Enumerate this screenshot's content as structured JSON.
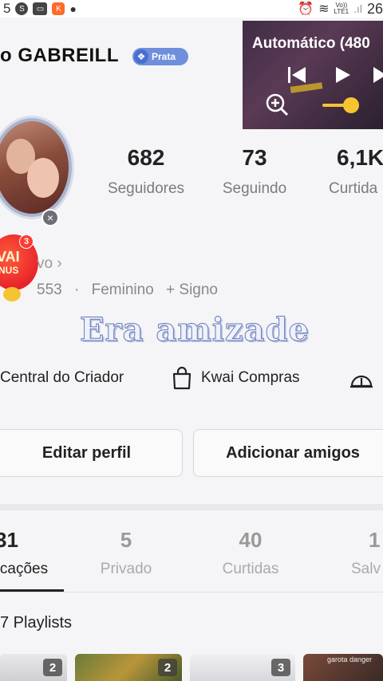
{
  "status_bar": {
    "left_text": "5",
    "right_text": "26",
    "network_label_top": "Vo))",
    "network_label_bottom": "LTE1"
  },
  "profile": {
    "username": "o GABREILL",
    "badge_label": "Prata",
    "badge_color": "#6f8fdc",
    "avatar_close": "×",
    "kwai_bonus_line1": "VAI",
    "kwai_bonus_line2": "NUS",
    "kwai_bonus_count": "3"
  },
  "video_player": {
    "title": "Automático (480",
    "zoom_level": 0.55,
    "accent_color": "#f6c430"
  },
  "stats": [
    {
      "value": "682",
      "label": "Seguidores"
    },
    {
      "value": "73",
      "label": "Seguindo"
    },
    {
      "value": "6,1K",
      "label": "Curtida"
    }
  ],
  "meta": {
    "row1": "vo ›",
    "id_fragment": "553",
    "separator": "·",
    "gender": "Feminino",
    "sign": "+ Signo"
  },
  "overlay_caption": "Era amizade",
  "shortcuts": [
    {
      "label": "Central do Criador",
      "icon": "none"
    },
    {
      "label": "Kwai Compras",
      "icon": "shopping-bag-icon"
    },
    {
      "label": "",
      "icon": "dome-icon"
    }
  ],
  "buttons": {
    "edit_profile": "Editar perfil",
    "add_friends": "Adicionar amigos"
  },
  "tabs": [
    {
      "count": "31",
      "label": "cações",
      "active": true
    },
    {
      "count": "5",
      "label": "Privado",
      "active": false
    },
    {
      "count": "40",
      "label": "Curtidas",
      "active": false
    },
    {
      "count": "1",
      "label": "Salv",
      "active": false
    }
  ],
  "playlists": {
    "title": "7 Playlists",
    "thumbnails": [
      {
        "count": "2"
      },
      {
        "count": "2"
      },
      {
        "count": "3"
      },
      {
        "count": "",
        "caption": "garota danger"
      }
    ]
  }
}
